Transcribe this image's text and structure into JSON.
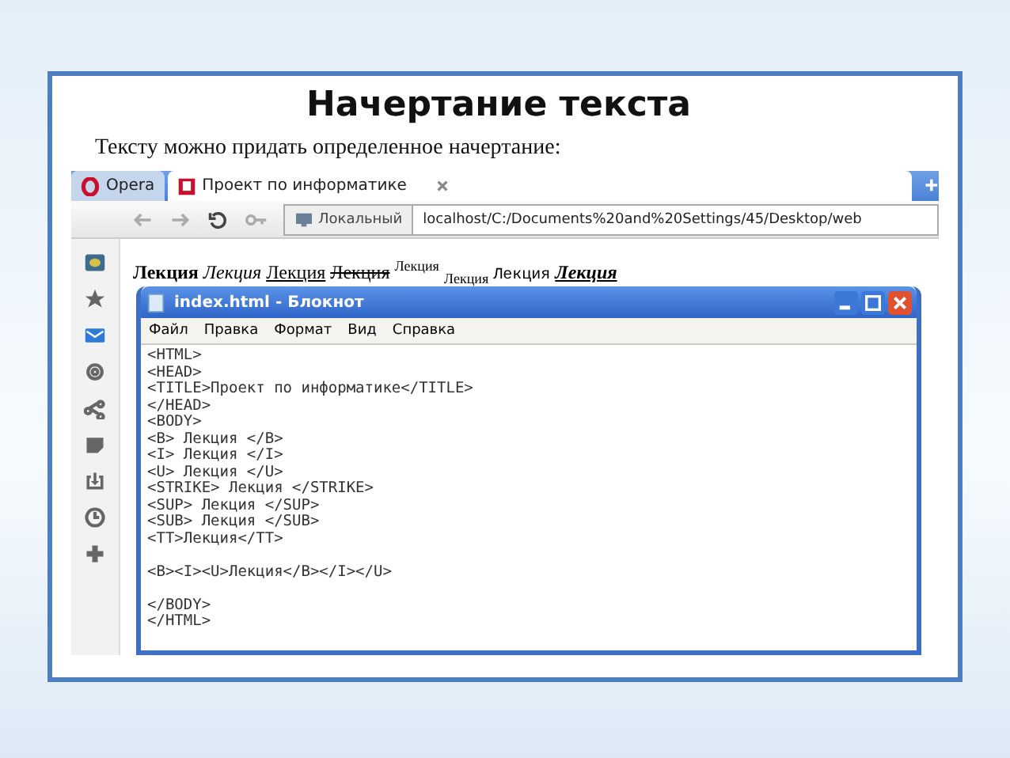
{
  "slide": {
    "title": "Начертание текста",
    "subtitle": "Тексту можно придать определенное начертание:"
  },
  "browser": {
    "tabs": [
      {
        "label": "Opera",
        "kind": "menu",
        "selected": false
      },
      {
        "label": "Проект по информатике",
        "kind": "page",
        "selected": true
      }
    ],
    "toolbar": {
      "badge": "Локальный",
      "url": "localhost/C:/Documents%20and%20Settings/45/Desktop/web"
    },
    "sidebar": [
      {
        "kind": "speed"
      },
      {
        "kind": "star"
      },
      {
        "kind": "mail"
      },
      {
        "kind": "gear"
      },
      {
        "kind": "share"
      },
      {
        "kind": "note"
      },
      {
        "kind": "download"
      },
      {
        "kind": "clock"
      },
      {
        "kind": "plus"
      }
    ],
    "preview": [
      {
        "kind": "bold",
        "text": "Лекция"
      },
      {
        "kind": "italic",
        "text": "Лекция"
      },
      {
        "kind": "underline",
        "text": "Лекция"
      },
      {
        "kind": "strike",
        "text": "Лекция"
      },
      {
        "kind": "sup",
        "text": "Лекция"
      },
      {
        "kind": "sub",
        "text": "Лекция"
      },
      {
        "kind": "tt",
        "text": "Лекция"
      },
      {
        "kind": "biu",
        "text": "Лекция"
      }
    ]
  },
  "notepad": {
    "title": "index.html - Блокнот",
    "menu": [
      "Файл",
      "Правка",
      "Формат",
      "Вид",
      "Справка"
    ],
    "blocks": [
      [
        "<HTML>",
        "<HEAD>",
        "<TITLE>Проект по информатике</TITLE>",
        "</HEAD>",
        "<BODY>",
        "<B> Лекция </B>",
        "<I> Лекция </I>",
        "<U> Лекция </U>",
        "<STRIKE> Лекция </STRIKE>",
        "<SUP> Лекция </SUP>",
        "<SUB> Лекция </SUB>",
        "<TT>Лекция</TT>"
      ],
      [
        "<B><I><U>Лекция</B></I></U>"
      ],
      [
        "</BODY>",
        "</HTML>"
      ]
    ]
  }
}
